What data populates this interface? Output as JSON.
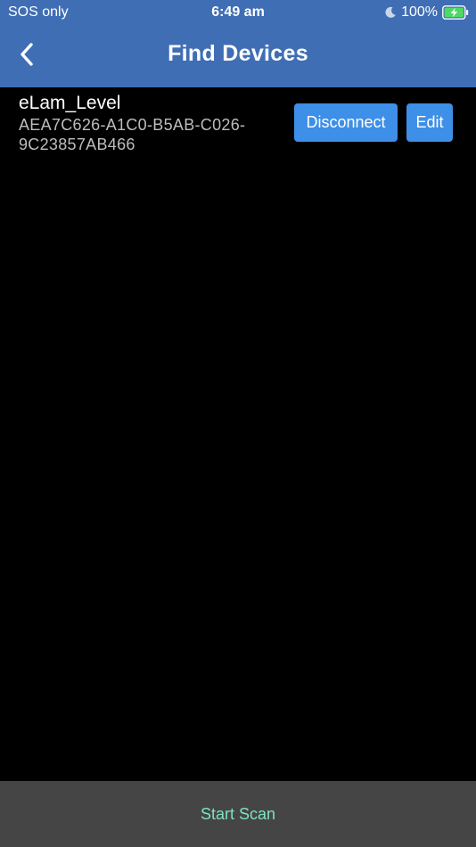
{
  "status_bar": {
    "carrier": "SOS only",
    "time": "6:49 am",
    "battery_percent": "100%",
    "icons": [
      "moon-icon",
      "battery-charging-icon"
    ]
  },
  "nav": {
    "back_icon": "chevron-left-icon",
    "title": "Find Devices"
  },
  "devices": [
    {
      "name": "eLam_Level",
      "id": "AEA7C626-A1C0-B5AB-C026-9C23857AB466",
      "disconnect_label": "Disconnect",
      "edit_label": "Edit"
    }
  ],
  "bottom": {
    "start_scan_label": "Start Scan"
  },
  "colors": {
    "header_bg": "#3f6eb5",
    "button_bg": "#3d8fe8",
    "bottom_bar_bg": "#454545",
    "scan_text": "#7fe3bd",
    "battery_green": "#4cd964"
  }
}
